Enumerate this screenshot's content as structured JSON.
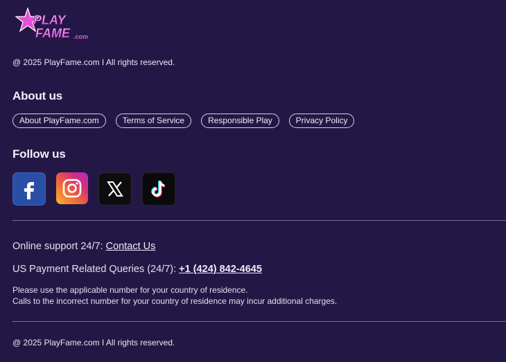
{
  "brand": {
    "logo_top": "PLAY",
    "logo_bottom": "FAME",
    "logo_suffix": ".com"
  },
  "copyright_top": "@ 2025 PlayFame.com I All rights reserved.",
  "about": {
    "title": "About us",
    "links": [
      "About PlayFame.com",
      "Terms of Service",
      "Responsible Play",
      "Privacy Policy"
    ]
  },
  "follow": {
    "title": "Follow us",
    "icons": [
      "facebook-icon",
      "instagram-icon",
      "x-icon",
      "tiktok-icon"
    ]
  },
  "support": {
    "online_label": "Online support 24/7: ",
    "contact_link": "Contact Us",
    "payment_label": "US Payment Related Queries (24/7): ",
    "phone": "+1 (424) 842-4645"
  },
  "notice": {
    "line1": "Please use the applicable number for your country of residence.",
    "line2": "Calls to the incorrect number for your country of residence may incur additional charges."
  },
  "copyright_bottom": "@ 2025 PlayFame.com I All rights reserved.",
  "colors": {
    "background": "#231845",
    "accent": "#c74bdc",
    "divider": "#7b6b99"
  }
}
